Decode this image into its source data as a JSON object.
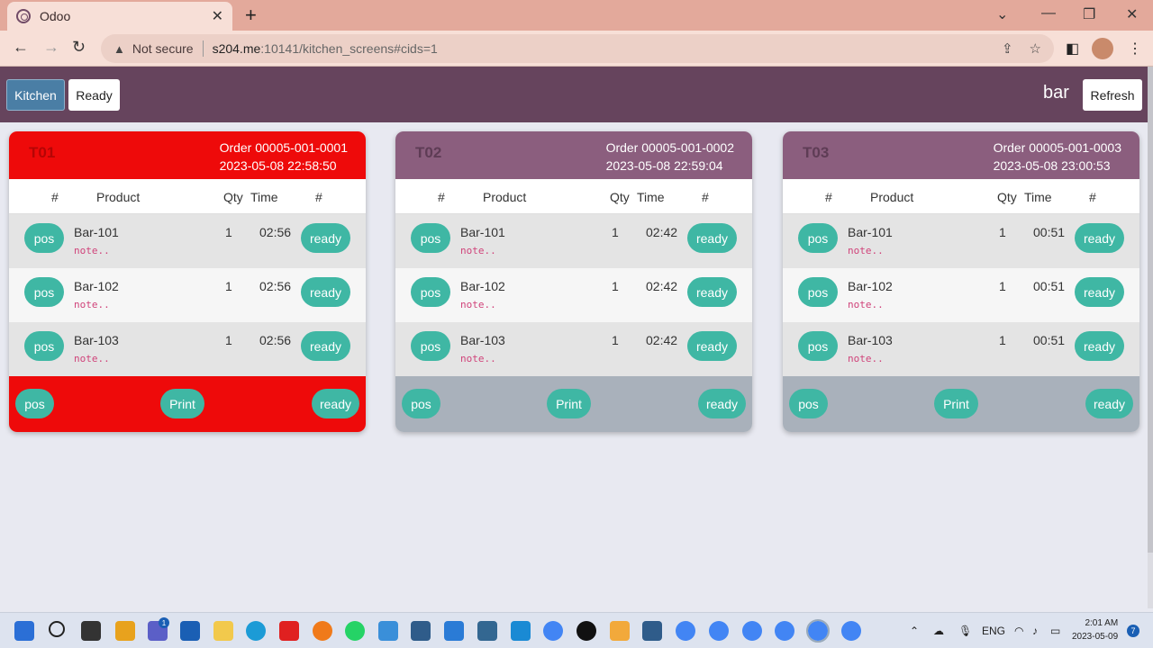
{
  "browser": {
    "tab_title": "Odoo",
    "tab_close": "✕",
    "new_tab": "+",
    "not_secure": "Not secure",
    "url_host": "s204.me",
    "url_rest": ":10141/kitchen_screens#cids=1"
  },
  "appbar": {
    "kitchen_label": "Kitchen",
    "ready_label": "Ready",
    "screen_name": "bar",
    "refresh_label": "Refresh"
  },
  "columns": {
    "num": "#",
    "product": "Product",
    "qty": "Qty",
    "time": "Time",
    "action": "#"
  },
  "orders": [
    {
      "table": "T01",
      "order_ref": "Order 00005-001-0001",
      "order_time": "2023-05-08 22:58:50",
      "status": "urgent",
      "lines": [
        {
          "pos": "pos",
          "product": "Bar-101",
          "note": "note..",
          "qty": "1",
          "time": "02:56",
          "ready": "ready"
        },
        {
          "pos": "pos",
          "product": "Bar-102",
          "note": "note..",
          "qty": "1",
          "time": "02:56",
          "ready": "ready"
        },
        {
          "pos": "pos",
          "product": "Bar-103",
          "note": "note..",
          "qty": "1",
          "time": "02:56",
          "ready": "ready"
        }
      ],
      "footer": {
        "pos": "pos",
        "print": "Print",
        "ready": "ready"
      }
    },
    {
      "table": "T02",
      "order_ref": "Order 00005-001-0002",
      "order_time": "2023-05-08 22:59:04",
      "status": "normal",
      "lines": [
        {
          "pos": "pos",
          "product": "Bar-101",
          "note": "note..",
          "qty": "1",
          "time": "02:42",
          "ready": "ready"
        },
        {
          "pos": "pos",
          "product": "Bar-102",
          "note": "note..",
          "qty": "1",
          "time": "02:42",
          "ready": "ready"
        },
        {
          "pos": "pos",
          "product": "Bar-103",
          "note": "note..",
          "qty": "1",
          "time": "02:42",
          "ready": "ready"
        }
      ],
      "footer": {
        "pos": "pos",
        "print": "Print",
        "ready": "ready"
      }
    },
    {
      "table": "T03",
      "order_ref": "Order 00005-001-0003",
      "order_time": "2023-05-08 23:00:53",
      "status": "normal",
      "lines": [
        {
          "pos": "pos",
          "product": "Bar-101",
          "note": "note..",
          "qty": "1",
          "time": "00:51",
          "ready": "ready"
        },
        {
          "pos": "pos",
          "product": "Bar-102",
          "note": "note..",
          "qty": "1",
          "time": "00:51",
          "ready": "ready"
        },
        {
          "pos": "pos",
          "product": "Bar-103",
          "note": "note..",
          "qty": "1",
          "time": "00:51",
          "ready": "ready"
        }
      ],
      "footer": {
        "pos": "pos",
        "print": "Print",
        "ready": "ready"
      }
    }
  ],
  "taskbar": {
    "lang": "ENG",
    "time": "2:01 AM",
    "date": "2023-05-09",
    "notifications": "7",
    "teams_badge": "1"
  },
  "colors": {
    "appbar": "#66445d",
    "urgent": "#ee0a0a",
    "normal_head": "#8b5e7e",
    "pill": "#3fb7a4",
    "kitchen_button": "#4a7ea5"
  }
}
